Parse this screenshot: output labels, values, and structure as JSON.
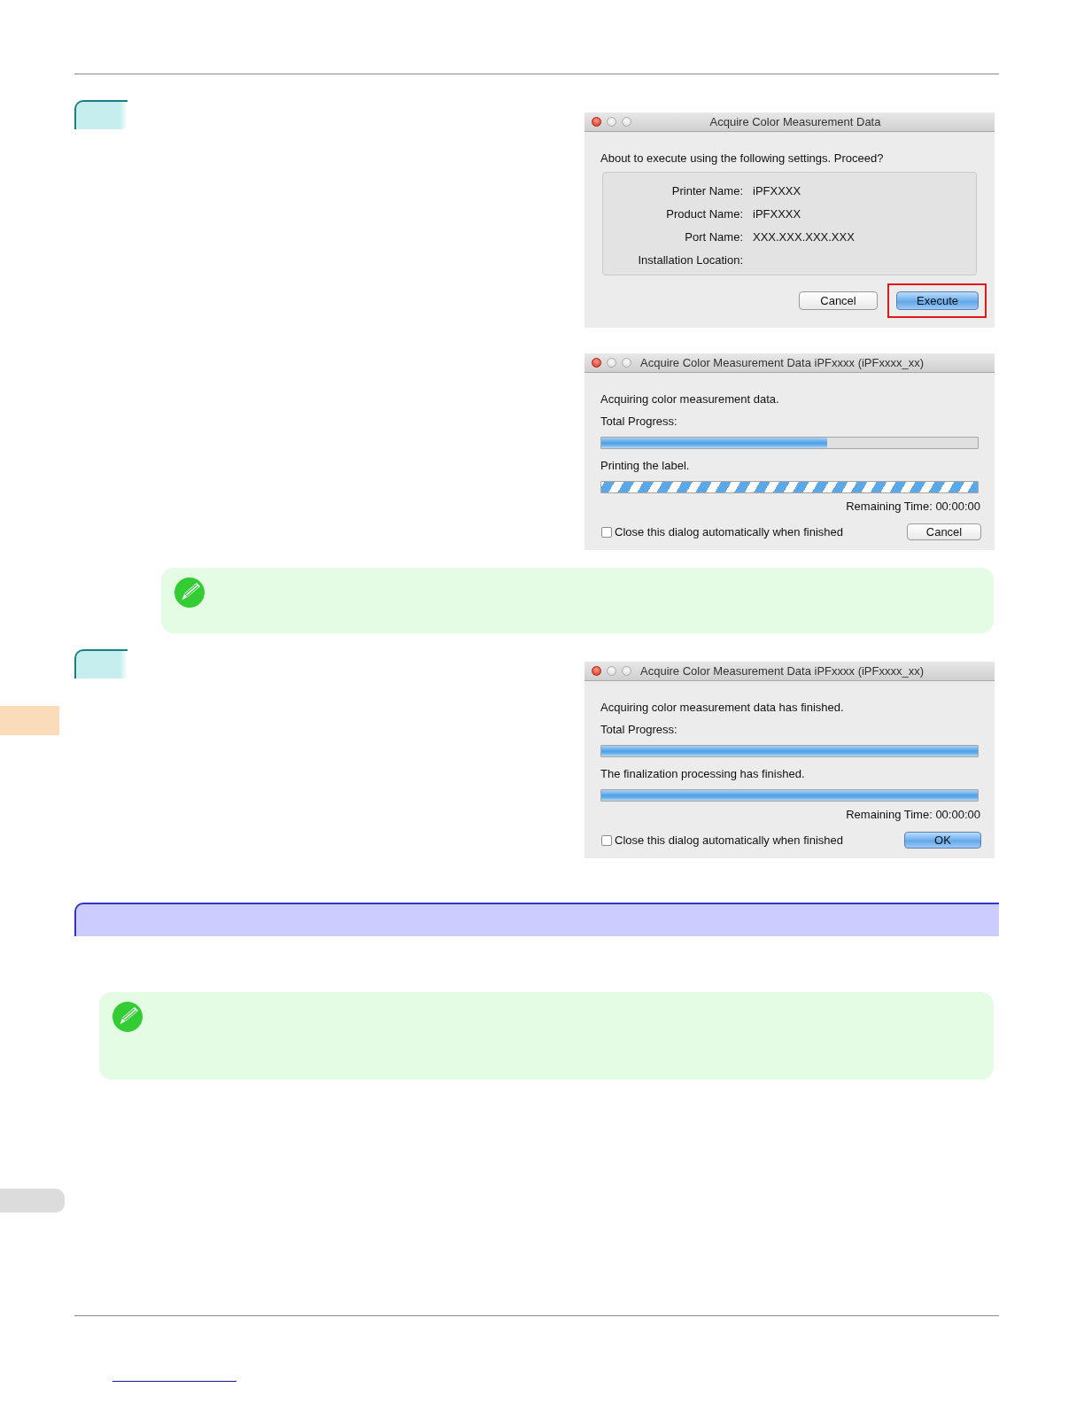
{
  "steps": [
    {
      "dialogs": [
        {
          "kind": "confirm",
          "title": "Acquire Color Measurement Data",
          "message": "About to execute using the following settings. Proceed?",
          "fields": [
            {
              "label": "Printer Name:",
              "value": "iPFXXXX"
            },
            {
              "label": "Product Name:",
              "value": "iPFXXXX"
            },
            {
              "label": "Port Name:",
              "value": "XXX.XXX.XXX.XXX"
            },
            {
              "label": "Installation Location:"
            }
          ],
          "buttons": [
            {
              "label": "Cancel",
              "default": false,
              "highlighted": false
            },
            {
              "label": "Execute",
              "default": true,
              "highlighted": true
            }
          ]
        },
        {
          "kind": "progress",
          "title": "Acquire Color Measurement Data iPFxxxx (iPFxxxx_xx)",
          "message": "Acquiring color measurement data.",
          "bars": [
            {
              "label": "Total Progress:",
              "kind": "determinate",
              "level": 0.6
            },
            {
              "label": "Printing the label.",
              "kind": "indeterminate"
            }
          ],
          "remaining": "Remaining Time: 00:00:00",
          "checkbox": {
            "label": "Close this dialog automatically when finished",
            "checked": false
          },
          "buttons": [
            {
              "label": "Cancel",
              "default": false,
              "highlighted": false
            }
          ]
        }
      ]
    },
    {
      "dialogs": [
        {
          "kind": "progress",
          "title": "Acquire Color Measurement Data iPFxxxx (iPFxxxx_xx)",
          "message": "Acquiring color measurement data has finished.",
          "bars": [
            {
              "label": "Total Progress:",
              "kind": "determinate",
              "level": 1
            },
            {
              "label": "The finalization processing has finished.",
              "kind": "determinate",
              "level": 1
            }
          ],
          "remaining": "Remaining Time: 00:00:00",
          "checkbox": {
            "label": "Close this dialog automatically when finished",
            "checked": false
          },
          "buttons": [
            {
              "label": "OK",
              "default": true,
              "highlighted": false
            }
          ]
        }
      ]
    }
  ]
}
